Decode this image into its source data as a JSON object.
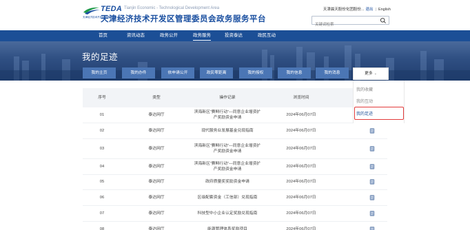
{
  "header": {
    "logo_teda": "TEDA",
    "logo_en": "Tianjin Economic - Technological Development Area",
    "logo_small_cn": "天津经济技术开发区管理委员会",
    "logo_cn": "天津经济技术开发区管理委员会政务服务平台",
    "user_text": "天津晨天股份化团股份...",
    "logout": "退出",
    "separator": "|",
    "language": "English",
    "search_placeholder": "关键词检索"
  },
  "nav": {
    "items": [
      {
        "label": "首页"
      },
      {
        "label": "资讯动态"
      },
      {
        "label": "政务公开"
      },
      {
        "label": "政务服务"
      },
      {
        "label": "投资泰达"
      },
      {
        "label": "政民互动"
      }
    ],
    "active_index": 3
  },
  "banner": {
    "title": "我的足迹",
    "tabs": [
      {
        "label": "我的主页"
      },
      {
        "label": "我的办件"
      },
      {
        "label": "依申请公开"
      },
      {
        "label": "政民零距离"
      },
      {
        "label": "我的授权"
      },
      {
        "label": "我的信息"
      },
      {
        "label": "我的消息"
      }
    ],
    "more_label": "更多",
    "more_caret": "⌄"
  },
  "dropdown": {
    "items": [
      {
        "label": "我的收藏"
      },
      {
        "label": "我的互动"
      },
      {
        "label": "我的足迹"
      }
    ],
    "selected_index": 2
  },
  "table": {
    "columns": [
      "序号",
      "类型",
      "操作记录",
      "浏览时间",
      ""
    ],
    "rows": [
      {
        "no": "01",
        "type": "泰达网厅",
        "record": "滨海新区“赛鲟行动”—同意企业增资扩产奖励资金申请",
        "time": "2024年06月07日"
      },
      {
        "no": "02",
        "type": "泰达网厅",
        "record": "现代服务业发展基金兑现指南",
        "time": "2024年06月07日"
      },
      {
        "no": "03",
        "type": "泰达网厅",
        "record": "滨海新区“赛鲟行动”—同意企业增资扩产奖励资金申请",
        "time": "2024年06月07日"
      },
      {
        "no": "04",
        "type": "泰达网厅",
        "record": "滨海新区“赛鲟行动”—同意企业增资扩产奖励资金申请",
        "time": "2024年06月07日"
      },
      {
        "no": "05",
        "type": "泰达网厅",
        "record": "政府质量奖奖励资金申请",
        "time": "2024年06月07日"
      },
      {
        "no": "06",
        "type": "泰达网厅",
        "record": "区级配套资金（工信部）兑现指南",
        "time": "2024年06月07日"
      },
      {
        "no": "07",
        "type": "泰达网厅",
        "record": "科技型中小企业认定奖励兑现指南",
        "time": "2024年06月07日"
      },
      {
        "no": "08",
        "type": "泰达网厅",
        "record": "能源管理体系奖励项目",
        "time": "2024年06月07日"
      }
    ]
  },
  "colors": {
    "primary": "#1c4f96",
    "tab": "#4b76b5",
    "highlight": "#e23b3b",
    "header_row": "#f2f4f7"
  }
}
